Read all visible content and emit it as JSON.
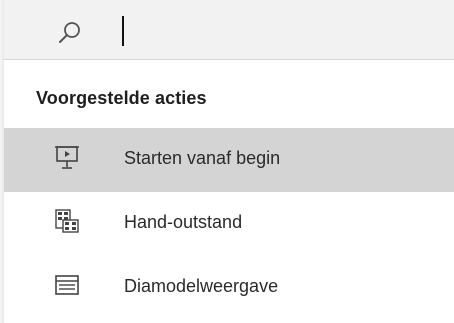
{
  "search": {
    "value": "",
    "icon": "search-icon"
  },
  "suggested": {
    "heading": "Voorgestelde acties",
    "items": [
      {
        "label": "Starten vanaf begin",
        "icon": "presenter-screen-icon",
        "selected": true
      },
      {
        "label": "Hand-outstand",
        "icon": "handout-layout-icon",
        "selected": false
      },
      {
        "label": "Diamodelweergave",
        "icon": "slide-master-icon",
        "selected": false
      }
    ]
  },
  "colors": {
    "selected_row": "#d4d4d4",
    "search_bar": "#f2f2f2",
    "text": "#2a2a2a"
  }
}
